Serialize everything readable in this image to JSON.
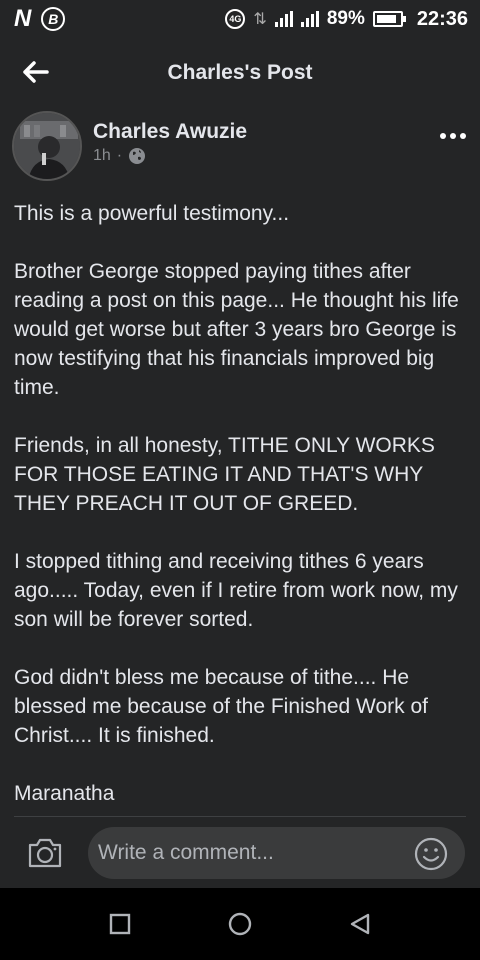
{
  "status_bar": {
    "left_icons": [
      "n-icon",
      "b-icon"
    ],
    "n_label": "N",
    "b_label": "B",
    "network_icon_label": "4G",
    "battery": "89%",
    "time": "22:36"
  },
  "header": {
    "title": "Charles's Post",
    "back_icon": "back-arrow-icon"
  },
  "post": {
    "author": "Charles Awuzie",
    "time_ago": "1h",
    "separator": "·",
    "audience_icon": "globe-icon",
    "paragraphs": [
      "This is a powerful testimony...",
      "Brother George stopped paying tithes after reading a post on this page... He thought his life would get worse but after 3 years bro George is now testifying that his financials improved big time.",
      "Friends, in all honesty, TITHE ONLY WORKS FOR THOSE EATING IT AND THAT'S WHY THEY PREACH IT OUT OF GREED.",
      "I stopped tithing and receiving tithes 6 years ago..... Today, even if I retire from work now, my son will be forever sorted.",
      "God didn't bless me because of tithe.... He blessed me because of the Finished Work of Christ.... It is finished.",
      "Maranatha"
    ]
  },
  "comment_bar": {
    "placeholder": "Write a comment...",
    "camera_icon": "camera-icon",
    "emoji_icon": "emoji-icon"
  },
  "colors": {
    "background": "#242526",
    "input_background": "#3a3b3c",
    "text": "#e4e6eb",
    "muted": "#8a8d91",
    "nav_bar": "#000000"
  }
}
